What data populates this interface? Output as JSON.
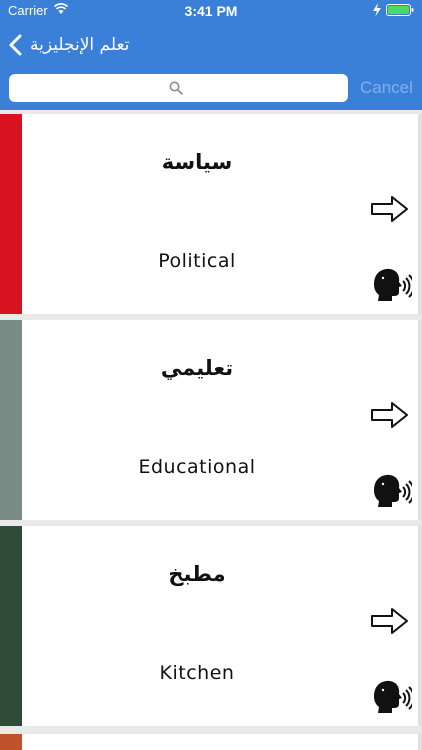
{
  "status_bar": {
    "carrier": "Carrier",
    "time": "3:41 PM"
  },
  "nav": {
    "back_label": "تعلم الإنجليزية"
  },
  "search": {
    "value": "",
    "placeholder": "",
    "cancel_label": "Cancel"
  },
  "cards": [
    {
      "arabic": "سياسة",
      "english": "Political",
      "stripe_color": "#d7141f"
    },
    {
      "arabic": "تعليمي",
      "english": "Educational",
      "stripe_color": "#7a8a84"
    },
    {
      "arabic": "مطبخ",
      "english": "Kitchen",
      "stripe_color": "#304c36"
    }
  ],
  "partial_card": {
    "stripe_color": "#c0522a"
  },
  "colors": {
    "nav_background": "#3a7fd8",
    "cancel_text": "#7fb0ee"
  }
}
